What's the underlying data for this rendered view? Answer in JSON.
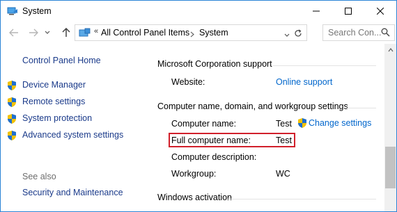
{
  "window": {
    "title": "System",
    "app_icon": "system-icon",
    "controls": [
      "minimize-icon",
      "maximize-icon",
      "close-icon"
    ]
  },
  "address_bar": {
    "crumbs": [
      "All Control Panel Items",
      "System"
    ],
    "location_icon": "control-panel-icon",
    "separator_prefix": "«"
  },
  "search": {
    "placeholder": "Search Con..."
  },
  "sidebar": {
    "home": "Control Panel Home",
    "items": [
      {
        "label": "Device Manager",
        "icon": "uac-shield-icon"
      },
      {
        "label": "Remote settings",
        "icon": "uac-shield-icon"
      },
      {
        "label": "System protection",
        "icon": "uac-shield-icon"
      },
      {
        "label": "Advanced system settings",
        "icon": "uac-shield-icon"
      }
    ],
    "see_also": "See also",
    "see_also_links": [
      "Security and Maintenance"
    ]
  },
  "main": {
    "support": {
      "title": "Microsoft Corporation support",
      "website_label": "Website:",
      "website_link": "Online support"
    },
    "computer": {
      "title": "Computer name, domain, and workgroup settings",
      "rows": [
        {
          "label": "Computer name:",
          "value": "Test"
        },
        {
          "label": "Full computer name:",
          "value": "Test"
        },
        {
          "label": "Computer description:",
          "value": ""
        },
        {
          "label": "Workgroup:",
          "value": "WC"
        }
      ],
      "change_settings": "Change settings"
    },
    "activation": {
      "title": "Windows activation"
    }
  },
  "colors": {
    "window_border": "#2b84d6",
    "link": "#0066cc",
    "sidebar_link": "#1a3a8a",
    "highlight_box": "#d11f2b"
  }
}
